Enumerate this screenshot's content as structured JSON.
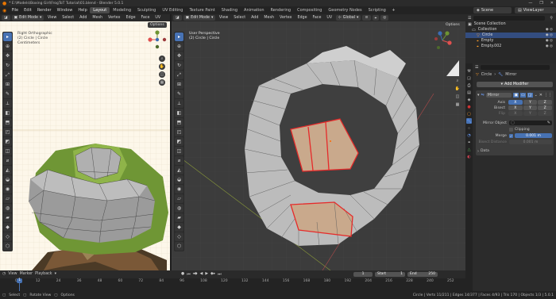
{
  "window": {
    "title": "* E:\\Models\\Boxing Girl\\FrogToT Tutorial\\01.blend - Blender 5.0.1",
    "min_label": "—",
    "max_label": "❐",
    "close_label": "✕"
  },
  "menu": {
    "items": [
      "File",
      "Edit",
      "Render",
      "Window",
      "Help"
    ],
    "workspaces": [
      "Layout",
      "Modeling",
      "Sculpting",
      "UV Editing",
      "Texture Paint",
      "Shading",
      "Animation",
      "Rendering",
      "Compositing",
      "Geometry Nodes",
      "Scripting"
    ],
    "active_workspace": "Layout",
    "scene": "Scene",
    "view_layer": "ViewLayer"
  },
  "left_viewport": {
    "mode": "Edit Mode",
    "menus": [
      "View",
      "Select",
      "Add",
      "Mesh",
      "Vertex",
      "Edge",
      "Face",
      "UV"
    ],
    "options_label": "Options",
    "overlay_lines": [
      "Right Orthographic",
      "(2) Circle | Circle",
      "Centimeters"
    ]
  },
  "right_viewport": {
    "mode": "Edit Mode",
    "menus": [
      "View",
      "Select",
      "Add",
      "Mesh",
      "Vertex",
      "Edge",
      "Face",
      "UV"
    ],
    "orientation": "Global",
    "options_label": "Options",
    "overlay_lines": [
      "User Perspective",
      "(2) Circle | Circle"
    ]
  },
  "gizmo": {
    "x": "X",
    "y": "Y",
    "z": "Z"
  },
  "outliner": {
    "collection": "Scene Collection",
    "items": [
      {
        "name": "Collection",
        "indent": 1
      },
      {
        "name": "Circle",
        "indent": 2
      },
      {
        "name": "Empty",
        "indent": 2
      },
      {
        "name": "Empty.002",
        "indent": 2
      }
    ]
  },
  "properties": {
    "breadcrumb_object": "Circle",
    "breadcrumb_modifier": "Mirror",
    "add_modifier_label": "Add Modifier",
    "modifier_name": "Mirror",
    "axis_label": "Axis",
    "bisect_label": "Bisect",
    "flip_label": "Flip",
    "axes": [
      "X",
      "Y",
      "Z"
    ],
    "mirror_object_label": "Mirror Object",
    "clipping_label": "Clipping",
    "merge_label": "Merge",
    "merge_value": "0.001 m",
    "bisect_distance_label": "Bisect Distance",
    "bisect_distance_value": "0.001 m",
    "data_label": "Data"
  },
  "timeline": {
    "menus": [
      "View",
      "Marker",
      "Playback"
    ],
    "current_frame": "1",
    "start_label": "Start",
    "start_value": "1",
    "end_label": "End",
    "end_value": "250",
    "ticks": [
      "0",
      "12",
      "24",
      "36",
      "48",
      "60",
      "72",
      "84",
      "96",
      "108",
      "120",
      "132",
      "144",
      "156",
      "168",
      "180",
      "192",
      "204",
      "216",
      "228",
      "240",
      "252"
    ]
  },
  "statusbar": {
    "left": [
      "Select",
      "Rotate View",
      "Options"
    ],
    "right": "Circle | Verts 11/211 | Edges 14/377 | Faces 4/93 | Tris 170 | Objects 1/3 | 5.0.1"
  },
  "colors": {
    "accent": "#4772b3",
    "selection": "#e62a2a",
    "mesh": "#b7b7b7",
    "grid_bg": "#fdf7ea"
  }
}
